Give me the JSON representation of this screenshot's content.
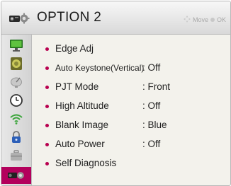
{
  "header": {
    "title": "OPTION 2",
    "hint_move": "Move",
    "hint_ok": "OK",
    "icon": "projector-gear-icon"
  },
  "sidebar": {
    "items": [
      {
        "name": "picture",
        "icon": "monitor-icon",
        "active": false
      },
      {
        "name": "sound",
        "icon": "speaker-icon",
        "active": false
      },
      {
        "name": "setup",
        "icon": "satellite-dish-icon",
        "active": false
      },
      {
        "name": "time",
        "icon": "clock-icon",
        "active": false
      },
      {
        "name": "network",
        "icon": "wifi-icon",
        "active": false
      },
      {
        "name": "lock",
        "icon": "lock-icon",
        "active": false
      },
      {
        "name": "option",
        "icon": "briefcase-icon",
        "active": false
      },
      {
        "name": "option2",
        "icon": "projector-gear-icon",
        "active": true
      }
    ]
  },
  "menu": {
    "items": [
      {
        "label": "Edge Adj",
        "value": ""
      },
      {
        "label": "Auto Keystone(Vertical)",
        "value": ": Off"
      },
      {
        "label": "PJT Mode",
        "value": ": Front"
      },
      {
        "label": "High Altitude",
        "value": ": Off"
      },
      {
        "label": "Blank Image",
        "value": ": Blue"
      },
      {
        "label": "Auto Power",
        "value": ": Off"
      },
      {
        "label": "Self Diagnosis",
        "value": ""
      }
    ]
  },
  "colors": {
    "accent": "#b3005c",
    "bullet": "#b8004f",
    "panel_bg": "#f3f2ec"
  }
}
